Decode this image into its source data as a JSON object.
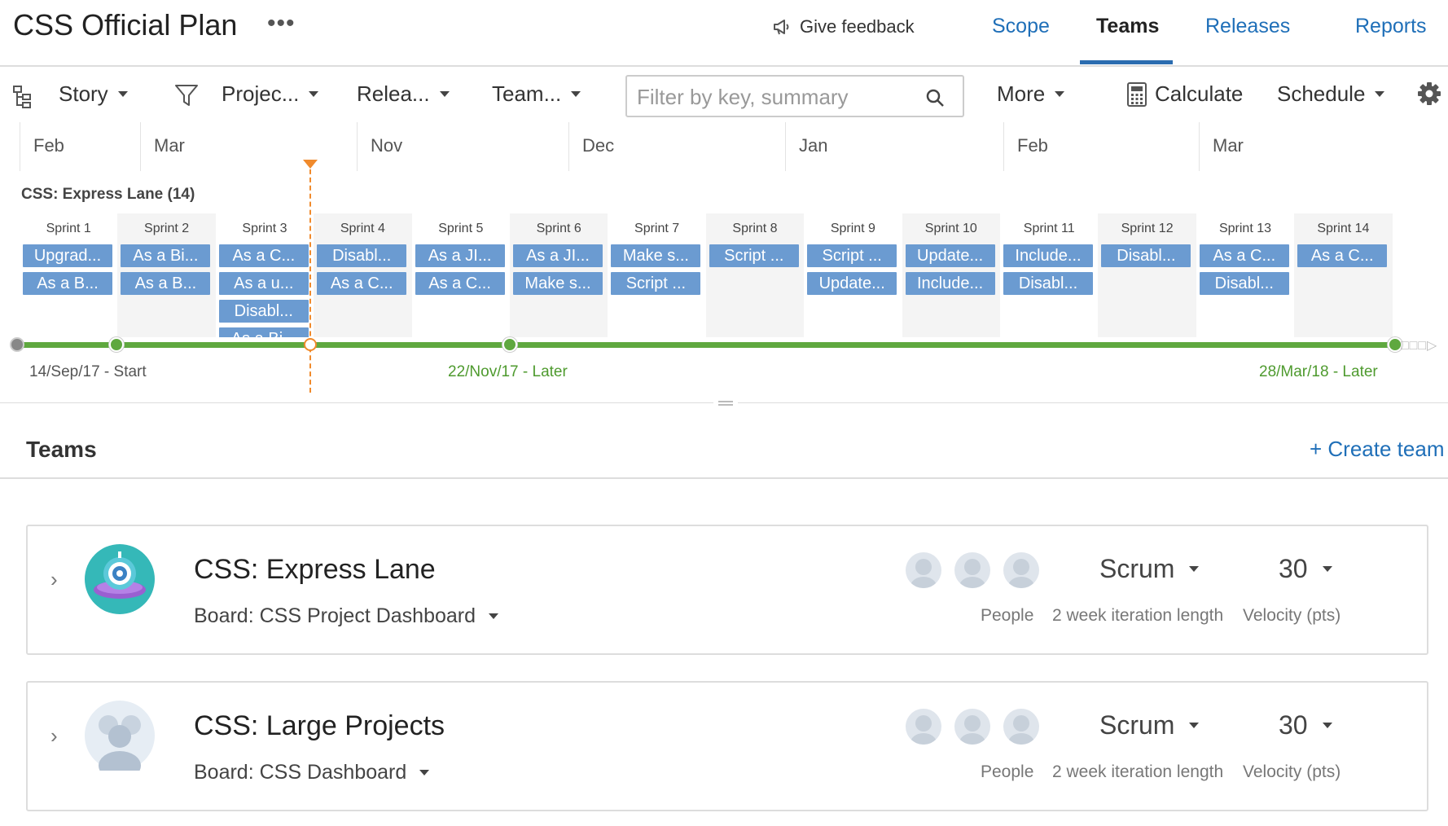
{
  "header": {
    "title": "CSS Official Plan",
    "more_label": "•••",
    "feedback_label": "Give feedback",
    "tabs": [
      {
        "label": "Scope",
        "active": false
      },
      {
        "label": "Teams",
        "active": true
      },
      {
        "label": "Releases",
        "active": false
      },
      {
        "label": "Reports",
        "active": false
      }
    ]
  },
  "toolbar": {
    "hierarchy_label": "Story",
    "project_filter": "Projec...",
    "release_filter": "Relea...",
    "team_filter": "Team...",
    "filter_placeholder": "Filter by key, summary",
    "more_label": "More",
    "calculate_label": "Calculate",
    "schedule_label": "Schedule"
  },
  "timeline": {
    "months": [
      "Feb",
      "Mar",
      "Nov",
      "Dec",
      "Jan",
      "Feb",
      "Mar"
    ],
    "lane_title": "CSS: Express Lane (14)",
    "sprints": [
      {
        "name": "Sprint 1",
        "issues": [
          "Upgrad...",
          "As a B..."
        ]
      },
      {
        "name": "Sprint 2",
        "issues": [
          "As a Bi...",
          "As a B..."
        ]
      },
      {
        "name": "Sprint 3",
        "issues": [
          "As a C...",
          "As a u...",
          "Disabl...",
          "As a Bi..."
        ]
      },
      {
        "name": "Sprint 4",
        "issues": [
          "Disabl...",
          "As a C..."
        ]
      },
      {
        "name": "Sprint 5",
        "issues": [
          "As a JI...",
          "As a C..."
        ]
      },
      {
        "name": "Sprint 6",
        "issues": [
          "As a JI...",
          "Make s..."
        ]
      },
      {
        "name": "Sprint 7",
        "issues": [
          "Make s...",
          "Script ..."
        ]
      },
      {
        "name": "Sprint 8",
        "issues": [
          "Script ..."
        ]
      },
      {
        "name": "Sprint 9",
        "issues": [
          "Script ...",
          "Update..."
        ]
      },
      {
        "name": "Sprint 10",
        "issues": [
          "Update...",
          "Include..."
        ]
      },
      {
        "name": "Sprint 11",
        "issues": [
          "Include...",
          "Disabl..."
        ]
      },
      {
        "name": "Sprint 12",
        "issues": [
          "Disabl..."
        ]
      },
      {
        "name": "Sprint 13",
        "issues": [
          "As a C...",
          "Disabl..."
        ]
      },
      {
        "name": "Sprint 14",
        "issues": [
          "As a C..."
        ]
      }
    ],
    "milestones": {
      "start": "14/Sep/17 - Start",
      "mid": "22/Nov/17 - Later",
      "end": "28/Mar/18 - Later"
    },
    "colors": {
      "progress": "#5fa83f",
      "today": "#f08a2c",
      "issue_chip": "#6b9bd1"
    }
  },
  "teams_section": {
    "heading": "Teams",
    "create_label": "+ Create team",
    "teams": [
      {
        "name": "CSS: Express Lane",
        "board": "Board: CSS Project Dashboard",
        "avatar_icon": "robot-avatar-icon",
        "method": "Scrum",
        "velocity": "30",
        "people_label": "People",
        "iteration_label": "2 week iteration length",
        "velocity_label": "Velocity (pts)"
      },
      {
        "name": "CSS: Large Projects",
        "board": "Board: CSS Dashboard",
        "avatar_icon": "group-avatar-icon",
        "method": "Scrum",
        "velocity": "30",
        "people_label": "People",
        "iteration_label": "2 week iteration length",
        "velocity_label": "Velocity (pts)"
      }
    ]
  }
}
